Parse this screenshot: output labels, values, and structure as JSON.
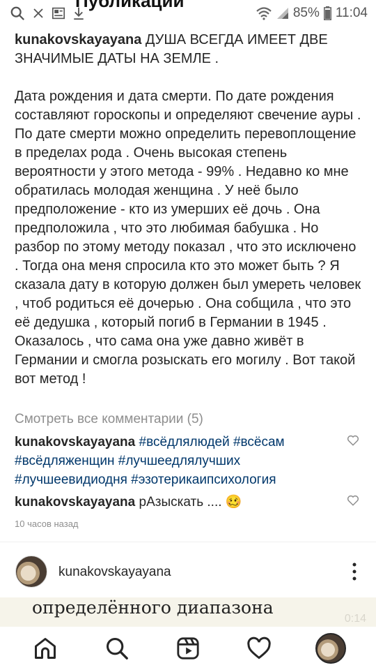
{
  "status_bar": {
    "battery": "85%",
    "time": "11:04",
    "partial_title": "Публикации"
  },
  "caption": {
    "username": "kunakovskayayana",
    "headline": "ДУША ВСЕГДА ИМЕЕТ ДВЕ ЗНАЧИМЫЕ ДАТЫ НА ЗЕМЛЕ .",
    "body": "Дата рождения и дата смерти. По дате рождения составляют гороскопы  и определяют свечение ауры . По дате смерти можно определить перевоплощение в пределах рода . Очень высокая степень вероятности у этого метода - 99% . Недавно ко мне обратилась молодая женщина . У неё было предположение - кто из умерших её дочь . Она предположила , что это любимая бабушка . Но разбор по этому методу показал , что это исключено . Тогда она меня спросила кто это может быть ? Я сказала дату в которую должен был умереть человек , чтоб родиться её дочерью . Она собщила , что это её дедушка , который погиб  в Германии в 1945 . Оказалось , что сама она уже давно живёт в Германии и смогла розыскать его могилу . Вот такой вот метод !"
  },
  "view_comments": "Смотреть все комментарии (5)",
  "comments": [
    {
      "username": "kunakovskayayana",
      "hashtags": "#всёдлялюдей #всёсам #всёдляженщин #лучшеедлялучших #лучшеевидиодня #эзотерикаипсихология"
    },
    {
      "username": "kunakovskayayana",
      "text": "рАзыскать ....",
      "emoji": "🥴"
    }
  ],
  "timestamp": "10 часов назад",
  "next_post": {
    "username": "kunakovskayayana",
    "media_text": "определённого диапазона",
    "media_time": "0:14"
  },
  "icons": [
    "search-icon",
    "news-icon",
    "download-icon",
    "wifi-icon",
    "signal-icon",
    "battery-icon",
    "heart-icon",
    "more-icon",
    "home-icon",
    "reels-icon"
  ]
}
